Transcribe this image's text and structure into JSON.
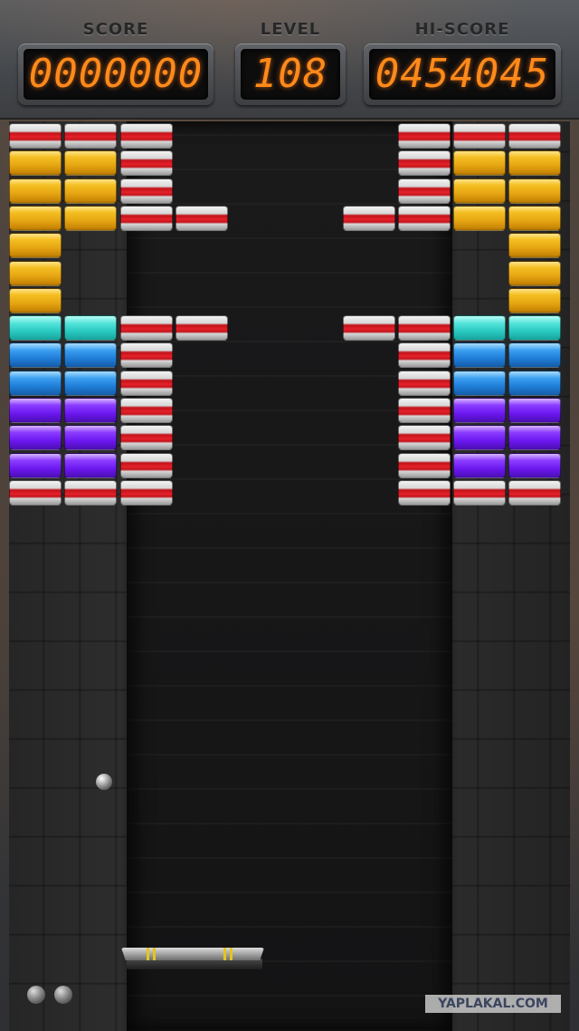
{
  "hud": {
    "score_label": "SCORE",
    "score_value": "0000000",
    "level_label": "LEVEL",
    "level_value": "108",
    "hiscore_label": "HI-SCORE",
    "hiscore_value": "0454045"
  },
  "colors": {
    "digits": "#ff8a1a",
    "red": "#e4222a",
    "gold": "#f4bf22",
    "cyan": "#29c9c0",
    "blue": "#1f7cd6",
    "purple": "#6a16ee"
  },
  "bricks": {
    "legend": {
      "R": "red",
      "G": "gold",
      "C": "cyan",
      "B": "blue",
      "P": "purple"
    },
    "rows": [
      "RRR...RRR",
      "GGR...RGG",
      "GGR...RGG",
      "GGRR.RRGG",
      "G.......G",
      "G.......G",
      "G.......G",
      "CCRR.RRCC",
      "BBR...RBB",
      "BBR...RBB",
      "PPR...RPP",
      "PPR...RPP",
      "PPR...RPP",
      "RRR...RRR"
    ]
  },
  "lives": 2,
  "watermark": "YAPLAKAL.COM"
}
